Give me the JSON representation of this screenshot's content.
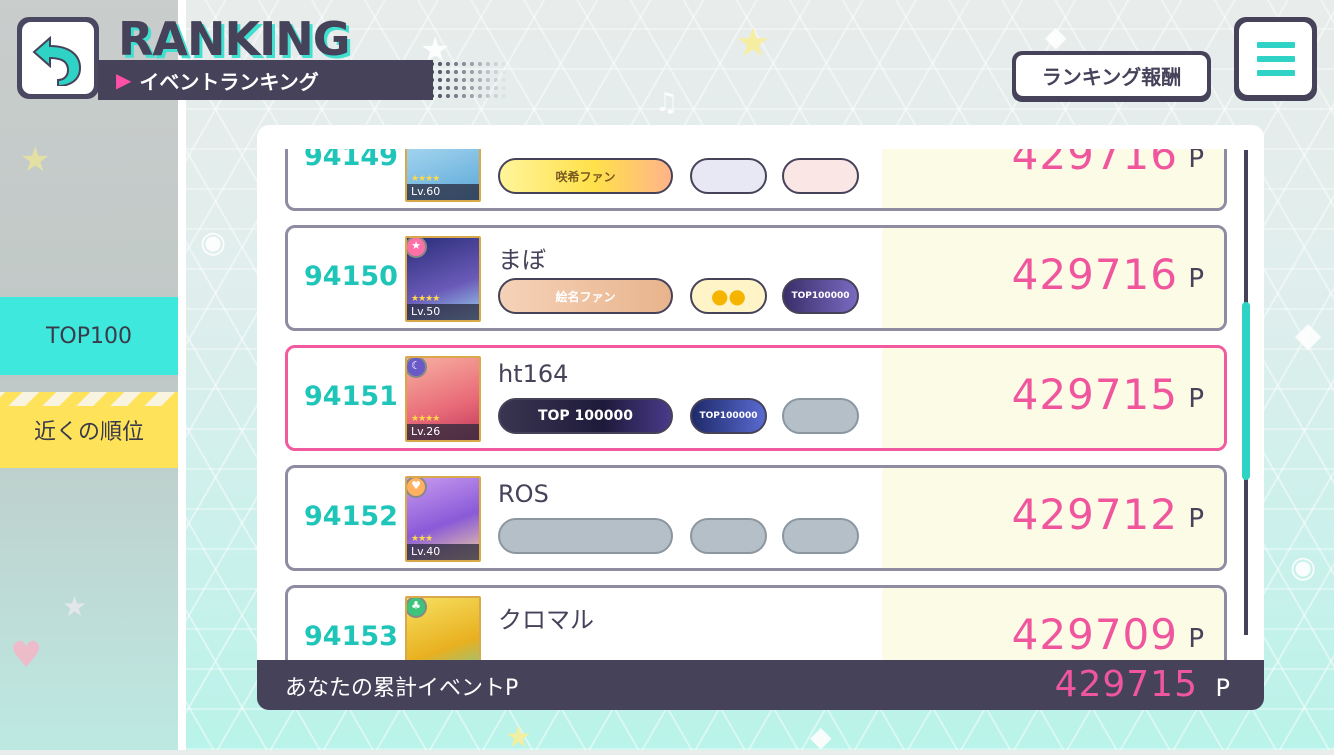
{
  "header": {
    "title": "RANKING",
    "subtitle": "イベントランキング",
    "reward_button": "ランキング報酬"
  },
  "tabs": {
    "top100": "TOP100",
    "nearby": "近くの順位"
  },
  "rows": [
    {
      "rank": "94149",
      "name": "",
      "level": "Lv.60",
      "points": "429716",
      "unit": "P",
      "badges": [
        "咲希ファン",
        "",
        ""
      ]
    },
    {
      "rank": "94150",
      "name": "まぼ",
      "level": "Lv.50",
      "points": "429716",
      "unit": "P",
      "badges": [
        "絵名ファン",
        "",
        "TOP100000"
      ]
    },
    {
      "rank": "94151",
      "name": "ht164",
      "level": "Lv.26",
      "points": "429715",
      "unit": "P",
      "badges": [
        "TOP 100000",
        "TOP100000",
        ""
      ]
    },
    {
      "rank": "94152",
      "name": "ROS",
      "level": "Lv.40",
      "points": "429712",
      "unit": "P",
      "badges": [
        "",
        "",
        ""
      ]
    },
    {
      "rank": "94153",
      "name": "クロマル",
      "level": "",
      "points": "429709",
      "unit": "P",
      "badges": [
        "",
        "",
        ""
      ]
    }
  ],
  "footer": {
    "label": "あなたの累計イベントP",
    "value": "429715",
    "unit": "P"
  },
  "colors": {
    "accent_teal": "#1ec5b8",
    "points_pink": "#f0569e",
    "frame_dark": "#454259",
    "highlight_border": "#f25aa0"
  },
  "icons": {
    "back": "back-arrow-icon",
    "menu": "hamburger-menu-icon"
  }
}
